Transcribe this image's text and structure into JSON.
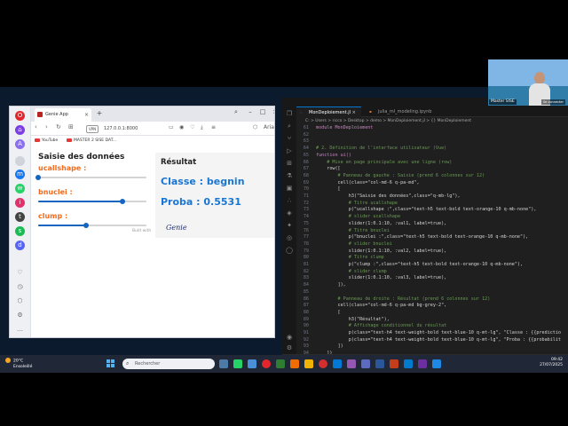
{
  "browser": {
    "tab_title": "Genie App",
    "url": "127.0.0.1:8000",
    "vpn_label": "VPN",
    "ai_label": "Aria",
    "bookmarks": [
      {
        "label": "YouTube"
      },
      {
        "label": "MASTER 2 SISE DAT..."
      }
    ]
  },
  "app": {
    "title": "Saisie des données",
    "sliders": [
      {
        "label": "ucallshape :",
        "value": 1,
        "min": 1,
        "max": 10
      },
      {
        "label": "bnuclei :",
        "value": 8,
        "min": 1,
        "max": 10
      },
      {
        "label": "clump :",
        "value": 5,
        "min": 1,
        "max": 10
      }
    ],
    "result_title": "Résultat",
    "classe_text": "Classe : begnin",
    "proba_text": "Proba : 0.5531",
    "built_with": "Built with",
    "genie_logo": "Genie"
  },
  "vscode": {
    "tabs": [
      {
        "label": "MonDeploiement.jl",
        "active": true
      },
      {
        "label": "julia_ml_modeling.ipynb",
        "active": false
      }
    ],
    "breadcrumb": "C: > Users > ricco > Desktop > demo > MonDeploiement.jl > {} MonDeploiement",
    "lines": [
      {
        "n": "61",
        "text": "module MonDeploiement"
      },
      {
        "n": "62",
        "text": ""
      },
      {
        "n": "63",
        "text": ""
      },
      {
        "n": "64",
        "text": "# 2. Définition de l'interface utilisateur (Vue)"
      },
      {
        "n": "65",
        "text": "function ui()"
      },
      {
        "n": "66",
        "text": "    # Mise en page principale avec une ligne (row)"
      },
      {
        "n": "67",
        "text": "    row(["
      },
      {
        "n": "68",
        "text": "        # Panneau de gauche : Saisie (prend 6 colonnes sur 12)"
      },
      {
        "n": "69",
        "text": "        cell(class=\"col-md-6 q-pa-md\","
      },
      {
        "n": "70",
        "text": "        ["
      },
      {
        "n": "71",
        "text": "            h3(\"Saisie des données\",class=\"q-mb-lg\"),"
      },
      {
        "n": "72",
        "text": "            # Titre ucallshape"
      },
      {
        "n": "73",
        "text": "            p(\"ucallshape :\",class=\"text-h5 text-bold text-orange-10 q-mb-none\"),"
      },
      {
        "n": "74",
        "text": "            # slider ucallshape"
      },
      {
        "n": "75",
        "text": "            slider(1:0.1:10, :val1, label=true),"
      },
      {
        "n": "76",
        "text": "            # Titre bnuclei"
      },
      {
        "n": "77",
        "text": "            p(\"bnuclei :\",class=\"text-h5 text-bold text-orange-10 q-mb-none\"),"
      },
      {
        "n": "78",
        "text": "            # slider bnuclei"
      },
      {
        "n": "79",
        "text": "            slider(1:0.1:10, :val2, label=true),"
      },
      {
        "n": "80",
        "text": "            # Titre clump"
      },
      {
        "n": "81",
        "text": "            p(\"clump :\",class=\"text-h5 text-bold text-orange-10 q-mb-none\"),"
      },
      {
        "n": "82",
        "text": "            # slider clump"
      },
      {
        "n": "83",
        "text": "            slider(1:0.1:10, :val3, label=true),"
      },
      {
        "n": "84",
        "text": "        ]),"
      },
      {
        "n": "85",
        "text": ""
      },
      {
        "n": "86",
        "text": "        # Panneau de droite : Résultat (prend 6 colonnes sur 12)"
      },
      {
        "n": "87",
        "text": "        cell(class=\"col-md-6 q-pa-md bg-grey-2\","
      },
      {
        "n": "88",
        "text": "        ["
      },
      {
        "n": "89",
        "text": "            h3(\"Résultat\"),"
      },
      {
        "n": "90",
        "text": "            # Affichage conditionnel du résultat"
      },
      {
        "n": "91",
        "text": "            p(class=\"text-h4 text-weight-bold text-blue-10 q-mt-lg\", \"Classe : {{predictio"
      },
      {
        "n": "92",
        "text": "            p(class=\"text-h4 text-weight-bold text-blue-10 q-mt-lg\", \"Proba : {{probabilit"
      },
      {
        "n": "93",
        "text": "        ])"
      },
      {
        "n": "94",
        "text": "    ])"
      }
    ],
    "status_left": "julia env: env_ml_genieframework",
    "status_right": "L 33, col 25   Spaces: 4   UTF-8   CRLF   {} Julia"
  },
  "webcam": {
    "name": "Master SISE",
    "connection": "Se connecter"
  },
  "taskbar": {
    "temp": "20°C",
    "weather": "Ensoleillé",
    "search_placeholder": "Rechercher",
    "time": "09:42",
    "date": "27/07/2025"
  },
  "colors": {
    "accent_orange": "#f26b1d",
    "accent_blue": "#1976d2",
    "slider_blue": "#1565c0"
  }
}
